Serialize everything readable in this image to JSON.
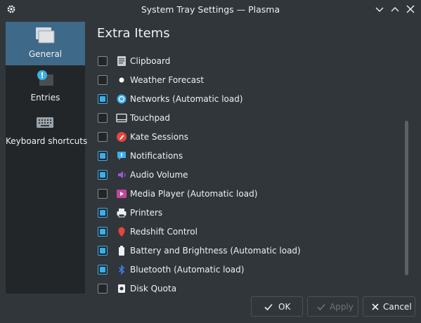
{
  "window": {
    "title": "System Tray Settings — Plasma"
  },
  "sidebar": {
    "items": [
      {
        "label": "General",
        "icon": "general-settings-icon",
        "active": true
      },
      {
        "label": "Entries",
        "icon": "entries-icon",
        "active": false
      },
      {
        "label": "Keyboard shortcuts",
        "icon": "keyboard-icon",
        "active": false
      }
    ]
  },
  "main": {
    "heading": "Extra Items",
    "items": [
      {
        "label": "Clipboard",
        "checked": false,
        "icon": "clipboard-icon"
      },
      {
        "label": "Weather Forecast",
        "checked": false,
        "icon": "weather-icon"
      },
      {
        "label": "Networks (Automatic load)",
        "checked": true,
        "icon": "network-icon"
      },
      {
        "label": "Touchpad",
        "checked": false,
        "icon": "touchpad-icon"
      },
      {
        "label": "Kate Sessions",
        "checked": false,
        "icon": "kate-icon"
      },
      {
        "label": "Notifications",
        "checked": true,
        "icon": "notifications-icon"
      },
      {
        "label": "Audio Volume",
        "checked": true,
        "icon": "audio-volume-icon"
      },
      {
        "label": "Media Player (Automatic load)",
        "checked": false,
        "icon": "media-player-icon"
      },
      {
        "label": "Printers",
        "checked": true,
        "icon": "printer-icon"
      },
      {
        "label": "Redshift Control",
        "checked": true,
        "icon": "redshift-icon"
      },
      {
        "label": "Battery and Brightness (Automatic load)",
        "checked": true,
        "icon": "battery-icon"
      },
      {
        "label": "Bluetooth (Automatic load)",
        "checked": true,
        "icon": "bluetooth-icon"
      },
      {
        "label": "Disk Quota",
        "checked": false,
        "icon": "disk-quota-icon"
      }
    ]
  },
  "buttons": {
    "ok": "OK",
    "apply": "Apply",
    "cancel": "Cancel"
  },
  "colors": {
    "background": "#31363b",
    "sidebar": "#232629",
    "selection": "#3f6989",
    "accent": "#3daee9"
  }
}
